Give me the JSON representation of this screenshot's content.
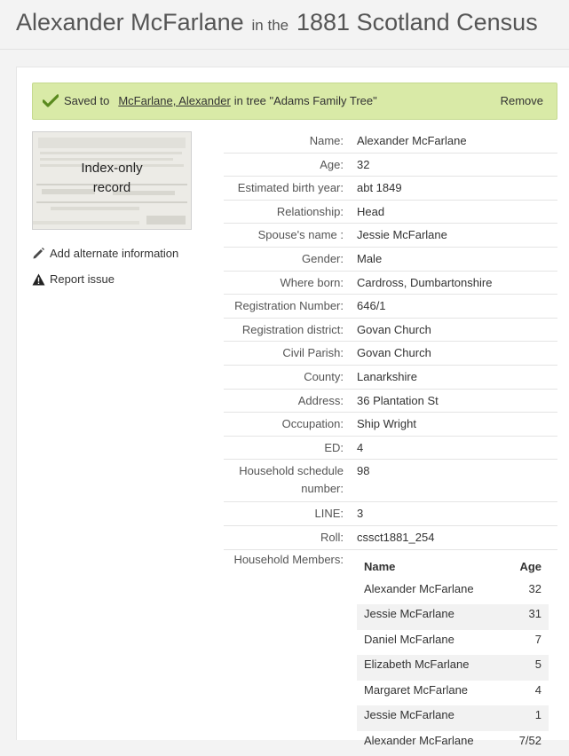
{
  "header": {
    "name": "Alexander McFarlane",
    "connector": "in the",
    "collection": "1881 Scotland Census"
  },
  "saved_bar": {
    "prefix": "Saved to",
    "link_text": "McFarlane, Alexander",
    "suffix": "in tree \"Adams Family Tree\"",
    "remove_label": "Remove",
    "accent": "#d9eaa7",
    "check_color": "#5a8a1e"
  },
  "thumbnail": {
    "label_line1": "Index-only",
    "label_line2": "record"
  },
  "actions": {
    "add_alternate": "Add alternate information",
    "report_issue": "Report issue"
  },
  "details": [
    {
      "label": "Name:",
      "value": "Alexander McFarlane"
    },
    {
      "label": "Age:",
      "value": "32"
    },
    {
      "label": "Estimated birth year:",
      "value": "abt 1849"
    },
    {
      "label": "Relationship:",
      "value": "Head"
    },
    {
      "label": "Spouse's name :",
      "value": "Jessie McFarlane"
    },
    {
      "label": "Gender:",
      "value": "Male"
    },
    {
      "label": "Where born:",
      "value": "Cardross, Dumbartonshire"
    },
    {
      "label": "Registration Number:",
      "value": "646/1"
    },
    {
      "label": "Registration district:",
      "value": "Govan Church"
    },
    {
      "label": "Civil Parish:",
      "value": "Govan Church"
    },
    {
      "label": "County:",
      "value": "Lanarkshire"
    },
    {
      "label": "Address:",
      "value": "36 Plantation St"
    },
    {
      "label": "Occupation:",
      "value": "Ship Wright"
    },
    {
      "label": "ED:",
      "value": "4"
    },
    {
      "label": "Household schedule number:",
      "value": "98"
    },
    {
      "label": "LINE:",
      "value": "3"
    },
    {
      "label": "Roll:",
      "value": "cssct1881_254"
    }
  ],
  "household": {
    "label": "Household Members:",
    "col_name": "Name",
    "col_age": "Age",
    "members": [
      {
        "name": "Alexander McFarlane",
        "age": "32"
      },
      {
        "name": "Jessie McFarlane",
        "age": "31"
      },
      {
        "name": "Daniel McFarlane",
        "age": "7"
      },
      {
        "name": "Elizabeth McFarlane",
        "age": "5"
      },
      {
        "name": "Margaret McFarlane",
        "age": "4"
      },
      {
        "name": "Jessie McFarlane",
        "age": "1"
      },
      {
        "name": "Alexander McFarlane",
        "age": "7/52"
      }
    ]
  }
}
